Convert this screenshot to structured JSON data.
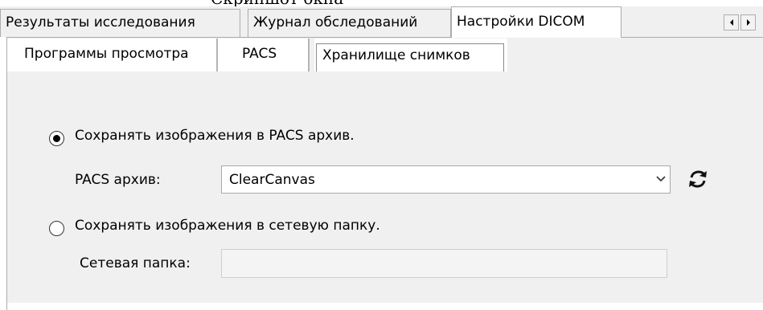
{
  "caption": "Скриншот окна",
  "main_tabs": [
    {
      "label": "Результаты исследования",
      "active": false
    },
    {
      "label": "Журнал обследований",
      "active": false
    },
    {
      "label": "Настройки DICOM",
      "active": true
    }
  ],
  "sub_tabs": [
    {
      "label": "Программы просмотра",
      "active": false
    },
    {
      "label": "PACS",
      "active": false
    },
    {
      "label": "Хранилище снимков",
      "active": true
    }
  ],
  "options": {
    "save_to_pacs": {
      "label": "Сохранять изображения в PACS архив.",
      "selected": true
    },
    "pacs_archive": {
      "label": "PACS архив:",
      "value": "ClearCanvas"
    },
    "save_to_folder": {
      "label": "Сохранять изображения в сетевую папку.",
      "selected": false
    },
    "network_folder": {
      "label": "Сетевая папка:",
      "value": ""
    }
  },
  "icons": {
    "scroll_left": "chevron-left-icon",
    "scroll_right": "chevron-right-icon",
    "dropdown": "chevron-down-icon",
    "refresh": "refresh-icon"
  }
}
